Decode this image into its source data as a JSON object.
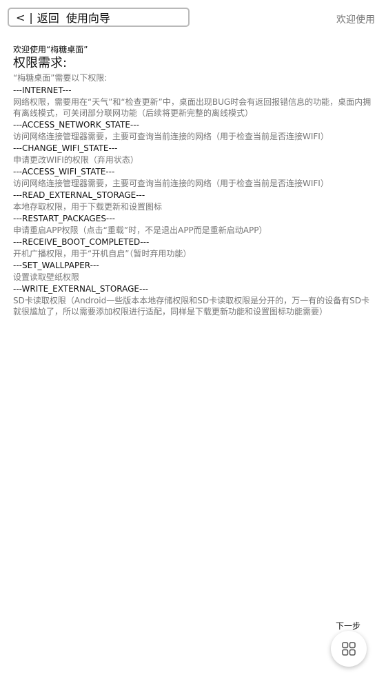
{
  "header": {
    "back_arrow": "<",
    "separator": "|",
    "back_label": "返回",
    "title": "使用向导",
    "welcome": "欢迎使用"
  },
  "content": {
    "subtitle": "欢迎使用“梅糖桌面”",
    "heading": "权限需求:",
    "intro": "“梅糖桌面”需要以下权限:",
    "permissions": [
      {
        "name": "---INTERNET---",
        "desc": "网络权限，需要用在“天气”和“检查更新”中，桌面出现BUG时会有返回报错信息的功能，桌面内拥有离线模式，可关闭部分联网功能（后续将更新完整的离线模式）"
      },
      {
        "name": "---ACCESS_NETWORK_STATE---",
        "desc": "访问网络连接管理器需要，主要可查询当前连接的网络（用于检查当前是否连接WIFI）"
      },
      {
        "name": "---CHANGE_WIFI_STATE---",
        "desc": "申请更改WIFI的权限（弃用状态）"
      },
      {
        "name": "---ACCESS_WIFI_STATE---",
        "desc": "访问网络连接管理器需要，主要可查询当前连接的网络（用于检查当前是否连接WIFI）"
      },
      {
        "name": "---READ_EXTERNAL_STORAGE---",
        "desc": "本地存取权限，用于下载更新和设置图标"
      },
      {
        "name": "---RESTART_PACKAGES---",
        "desc": "申请重启APP权限（点击“重载”时，不是退出APP而是重新启动APP）"
      },
      {
        "name": "---RECEIVE_BOOT_COMPLETED---",
        "desc": "开机广播权限，用于“开机自启”（暂时弃用功能）"
      },
      {
        "name": "---SET_WALLPAPER---",
        "desc": "设置读取壁纸权限"
      },
      {
        "name": "---WRITE_EXTERNAL_STORAGE---",
        "desc": "SD卡读取权限（Android一些版本本地存储权限和SD卡读取权限是分开的，万一有的设备有SD卡就很尴尬了，所以需要添加权限进行适配，同样是下载更新功能和设置图标功能需要）"
      }
    ]
  },
  "footer": {
    "next_label": "下一步",
    "fab_icon": "grid-icon"
  }
}
